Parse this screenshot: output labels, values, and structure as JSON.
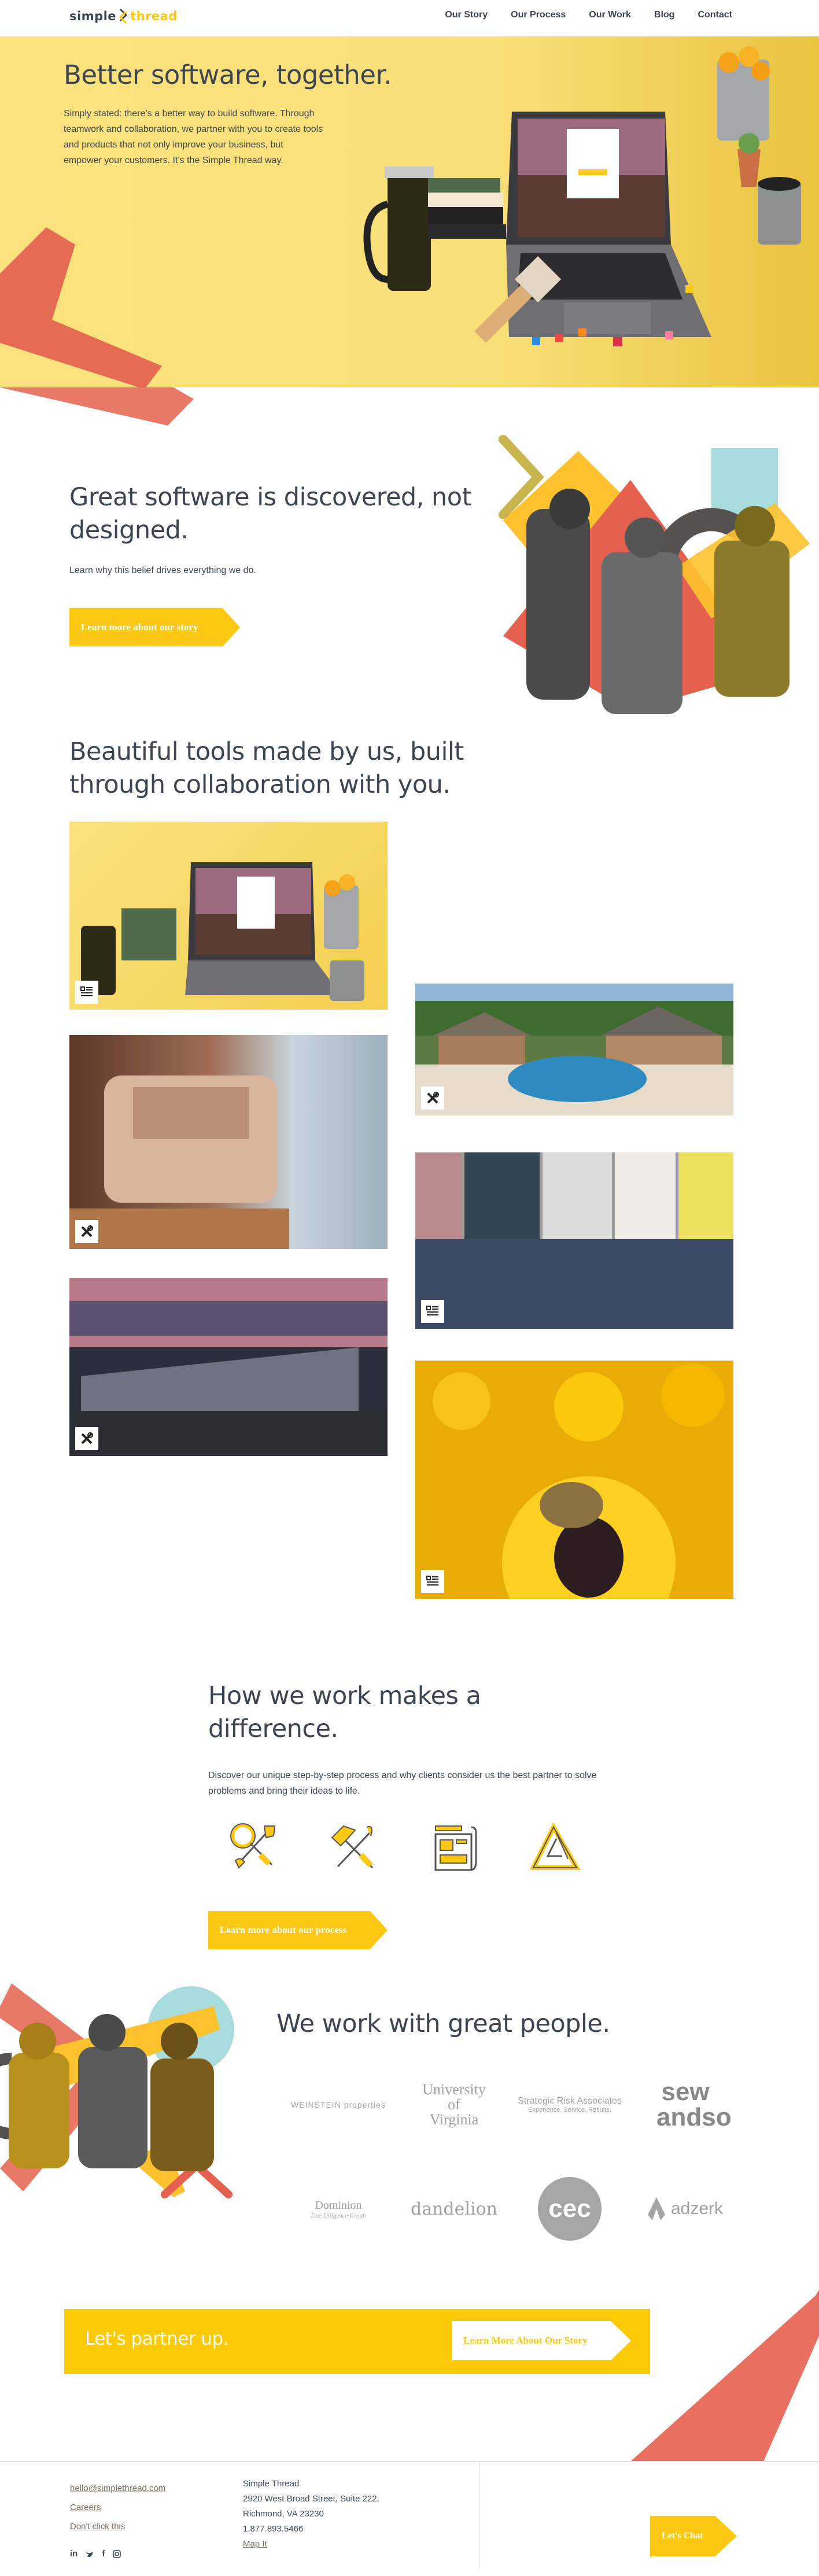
{
  "nav": {
    "logo_part1": "simple",
    "logo_part2": "thread",
    "links": [
      "Our Story",
      "Our Process",
      "Our Work",
      "Blog",
      "Contact"
    ]
  },
  "hero": {
    "title": "Better software, together.",
    "body": "Simply stated: there’s a better way to build software. Through teamwork and collaboration, we partner with you to create tools and products that not only improve your business, but empower your customers. It’s the Simple Thread way.",
    "photo_alt": "Laptop showing Simple Thread sign-in screen on a yellow desk"
  },
  "story": {
    "title": "Great software is discovered, not designed.",
    "body": "Learn why this belief drives everything we do.",
    "button": "Learn more about our story"
  },
  "tools": {
    "title": "Beautiful tools made by us, built through collaboration with you.",
    "tiles": [
      {
        "subject": "laptop-desk",
        "badge": "article-icon"
      },
      {
        "subject": "apartment-pool",
        "badge": "tools-icon"
      },
      {
        "subject": "paymaster-machine",
        "badge": "tools-icon"
      },
      {
        "subject": "people-standing",
        "badge": "article-icon"
      },
      {
        "subject": "townhouses-dusk",
        "badge": "tools-icon"
      },
      {
        "subject": "bee-on-flower",
        "badge": "article-icon"
      }
    ]
  },
  "process": {
    "title": "How we work makes a difference.",
    "body": "Discover our unique step-by-step process and why clients consider us the best partner to solve problems and bring their ideas to life.",
    "icons": [
      "discover-icon",
      "build-icon",
      "plan-icon",
      "iterate-icon"
    ],
    "button": "Learn more about our process"
  },
  "people": {
    "title": "We work with great people.",
    "clients": [
      {
        "name": "WEINSTEIN properties"
      },
      {
        "name": "University of Virginia"
      },
      {
        "name": "Strategic Risk Associates",
        "tagline": "Experience. Service. Results."
      },
      {
        "name": "sew andso"
      },
      {
        "name": "Dominion",
        "tagline": "Due Diligence Group"
      },
      {
        "name": "dandelion"
      },
      {
        "name": "cec"
      },
      {
        "name": "adzerk"
      }
    ]
  },
  "partner": {
    "title": "Let's partner up.",
    "button": "Learn More About Our Story"
  },
  "footer": {
    "email": "hello@simplethread.com",
    "careers": "Careers",
    "dont_click": "Don't click this",
    "social": [
      "linkedin-icon",
      "twitter-icon",
      "facebook-icon",
      "instagram-icon"
    ],
    "company": "Simple Thread",
    "address1": "2920 West Broad Street, Suite 222,",
    "address2": "Richmond, VA 23230",
    "phone": "1.877.893.5466",
    "map": "Map It",
    "chat_button": "Let's Chat"
  },
  "colors": {
    "brand_yellow": "#fdc915",
    "coral": "#e4614f",
    "text_dark": "#3d4551",
    "link_brown": "#7c6f66"
  }
}
